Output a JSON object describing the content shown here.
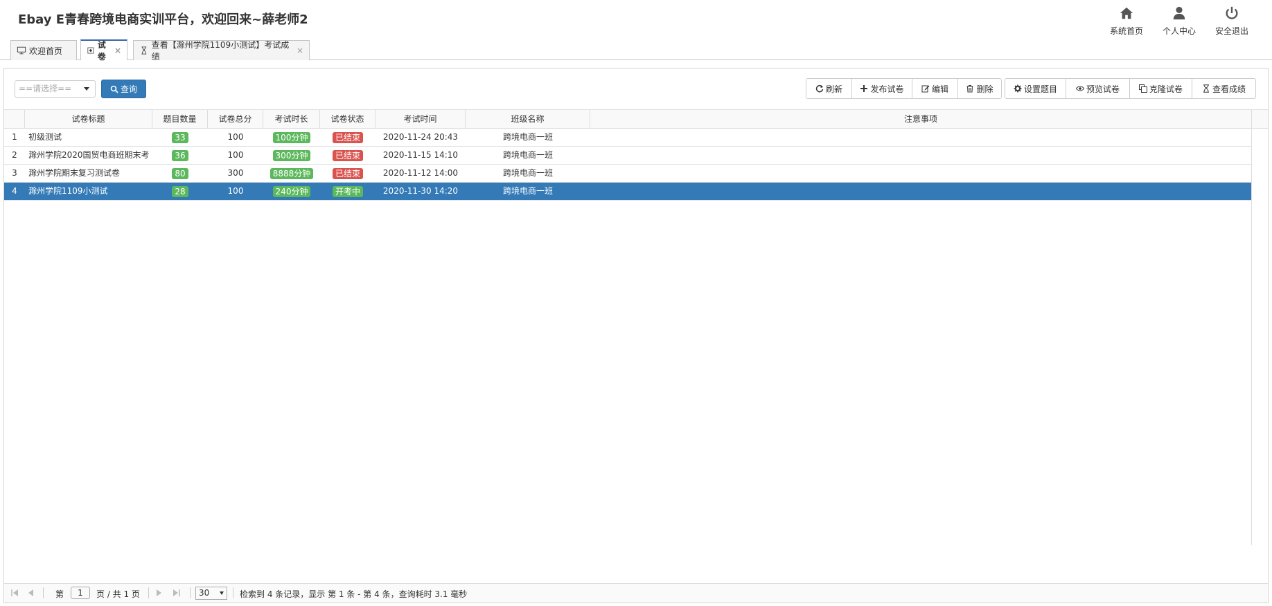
{
  "header": {
    "title": "Ebay E青春跨境电商实训平台，欢迎回来~薛老师2",
    "nav": [
      {
        "label": "系统首页",
        "icon": "home-icon"
      },
      {
        "label": "个人中心",
        "icon": "user-icon"
      },
      {
        "label": "安全退出",
        "icon": "power-icon"
      }
    ]
  },
  "tabs": [
    {
      "label": "欢迎首页",
      "icon": "monitor-icon",
      "closable": false
    },
    {
      "label": "试卷",
      "icon": "file-icon",
      "closable": true,
      "active": true
    },
    {
      "label": "查看【滁州学院1109小测试】考试成绩",
      "icon": "hourglass-icon",
      "closable": true
    }
  ],
  "toolbar": {
    "select_placeholder": "==请选择==",
    "query_label": "查询",
    "group1": [
      "刷新",
      "发布试卷",
      "编辑",
      "删除"
    ],
    "group2": [
      "设置题目",
      "预览试卷",
      "克隆试卷",
      "查看成绩"
    ]
  },
  "grid": {
    "columns": [
      "试卷标题",
      "题目数量",
      "试卷总分",
      "考试时长",
      "试卷状态",
      "考试时间",
      "班级名称",
      "注意事项"
    ],
    "rows": [
      {
        "num": "1",
        "title": "初级测试",
        "count": "33",
        "score": "100",
        "duration": "100分钟",
        "status": "已结束",
        "status_color": "red",
        "time": "2020-11-24 20:43",
        "class": "跨境电商一班",
        "notes": ""
      },
      {
        "num": "2",
        "title": "滁州学院2020国贸电商班期末考",
        "count": "36",
        "score": "100",
        "duration": "300分钟",
        "status": "已结束",
        "status_color": "red",
        "time": "2020-11-15 14:10",
        "class": "跨境电商一班",
        "notes": ""
      },
      {
        "num": "3",
        "title": "滁州学院期末复习测试卷",
        "count": "80",
        "score": "300",
        "duration": "8888分钟",
        "status": "已结束",
        "status_color": "red",
        "time": "2020-11-12 14:00",
        "class": "跨境电商一班",
        "notes": ""
      },
      {
        "num": "4",
        "title": "滁州学院1109小测试",
        "count": "28",
        "score": "100",
        "duration": "240分钟",
        "status": "开考中",
        "status_color": "green",
        "time": "2020-11-30 14:20",
        "class": "跨境电商一班",
        "notes": "",
        "selected": true
      }
    ]
  },
  "pager": {
    "page_prefix": "第",
    "page_value": "1",
    "page_suffix": "页 / 共 1 页",
    "page_size": "30",
    "summary": "检索到 4 条记录，显示 第 1 条 - 第 4 条，查询耗时 3.1 毫秒"
  },
  "colors": {
    "primary": "#337ab7",
    "badge_green": "#5cb85c",
    "badge_red": "#d9534f"
  }
}
